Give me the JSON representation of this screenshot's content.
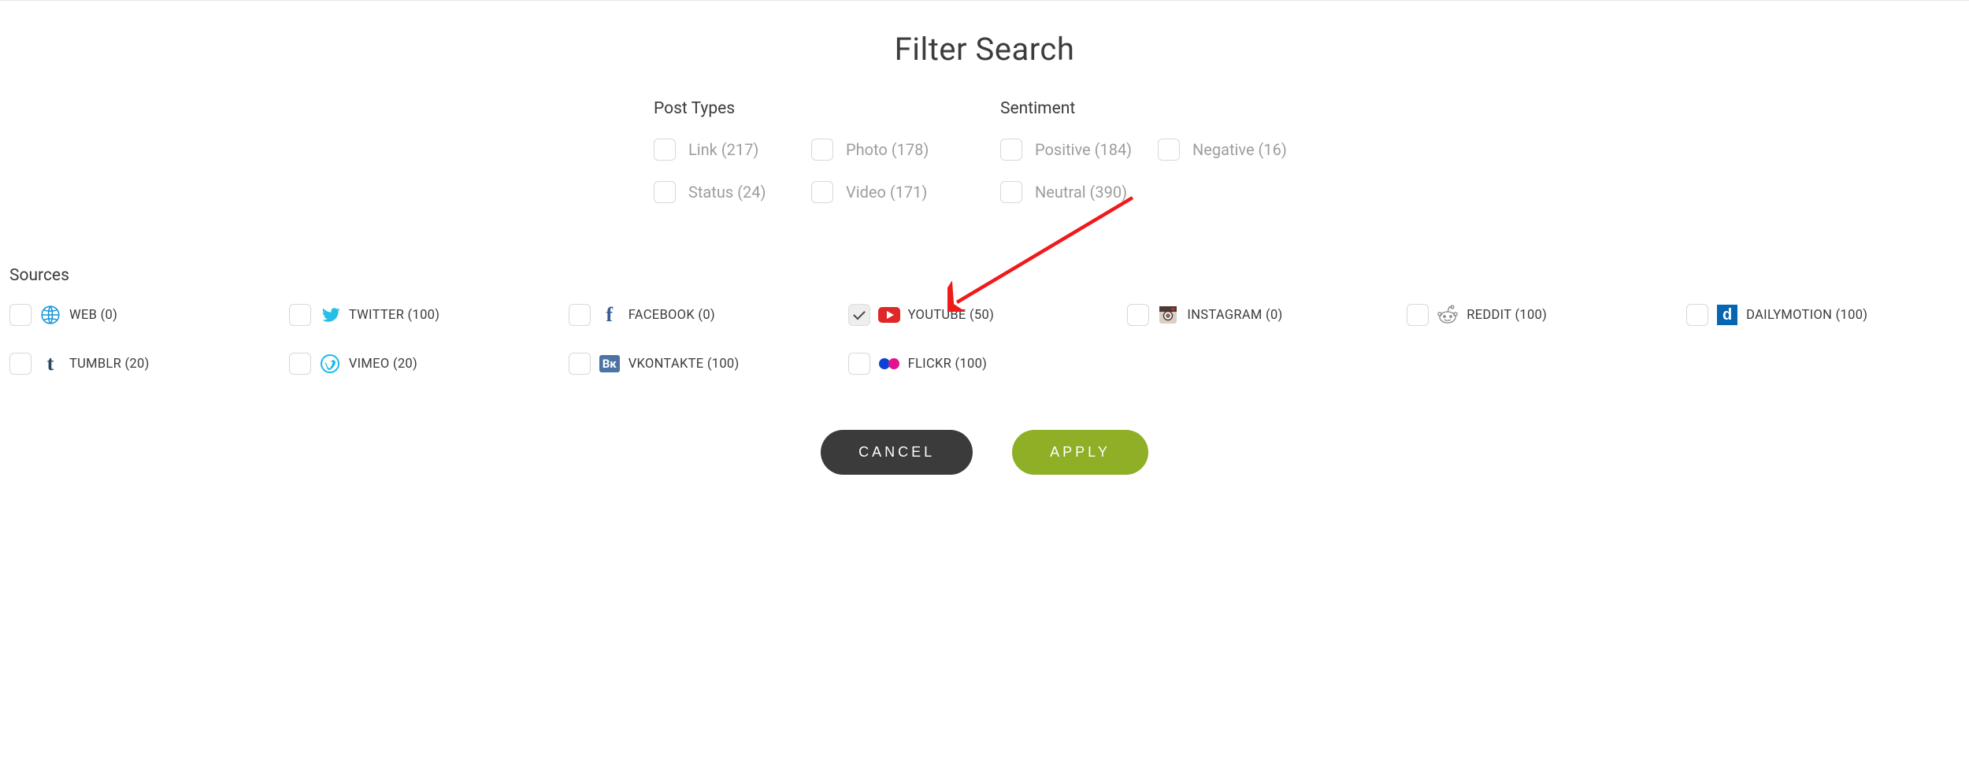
{
  "title": "Filter Search",
  "postTypes": {
    "label": "Post Types",
    "items": [
      {
        "label": "Link (217)"
      },
      {
        "label": "Photo (178)"
      },
      {
        "label": "Status (24)"
      },
      {
        "label": "Video (171)"
      }
    ]
  },
  "sentiment": {
    "label": "Sentiment",
    "items": [
      {
        "label": "Positive (184)"
      },
      {
        "label": "Negative (16)"
      },
      {
        "label": "Neutral (390)"
      }
    ]
  },
  "sources": {
    "label": "Sources",
    "items": [
      {
        "key": "web",
        "label": "WEB (0)",
        "checked": false
      },
      {
        "key": "twitter",
        "label": "TWITTER (100)",
        "checked": false
      },
      {
        "key": "facebook",
        "label": "FACEBOOK (0)",
        "checked": false
      },
      {
        "key": "youtube",
        "label": "YOUTUBE (50)",
        "checked": true
      },
      {
        "key": "instagram",
        "label": "INSTAGRAM (0)",
        "checked": false
      },
      {
        "key": "reddit",
        "label": "REDDIT (100)",
        "checked": false
      },
      {
        "key": "dailymotion",
        "label": "DAILYMOTION (100)",
        "checked": false
      },
      {
        "key": "tumblr",
        "label": "TUMBLR (20)",
        "checked": false
      },
      {
        "key": "vimeo",
        "label": "VIMEO (20)",
        "checked": false
      },
      {
        "key": "vkontakte",
        "label": "VKONTAKTE (100)",
        "checked": false
      },
      {
        "key": "flickr",
        "label": "FLICKR (100)",
        "checked": false
      }
    ]
  },
  "buttons": {
    "cancel": "CANCEL",
    "apply": "APPLY"
  }
}
